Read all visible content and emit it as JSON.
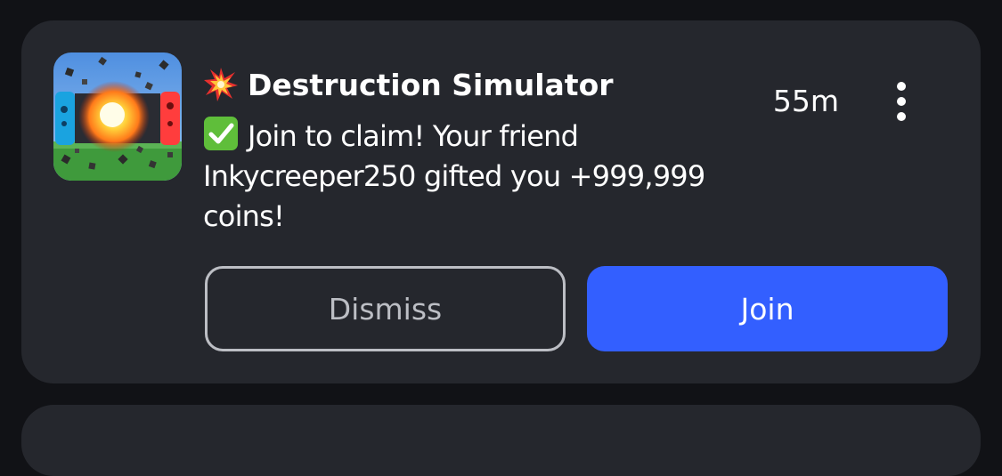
{
  "notification": {
    "game_title": "Destruction Simulator",
    "title_emoji": "collision-icon",
    "time_ago": "55m",
    "message": "Join to claim! Your friend Inkycreeper250 gifted you +999,999 coins!",
    "message_emoji": "check-mark-button-icon",
    "dismiss_label": "Dismiss",
    "join_label": "Join",
    "menu_icon": "more-vertical-icon",
    "thumbnail_icon": "game-thumbnail-explosion"
  },
  "colors": {
    "card_background": "#25272d",
    "page_background": "#111216",
    "join_button": "#335fff",
    "dismiss_border": "#bcbec4"
  }
}
